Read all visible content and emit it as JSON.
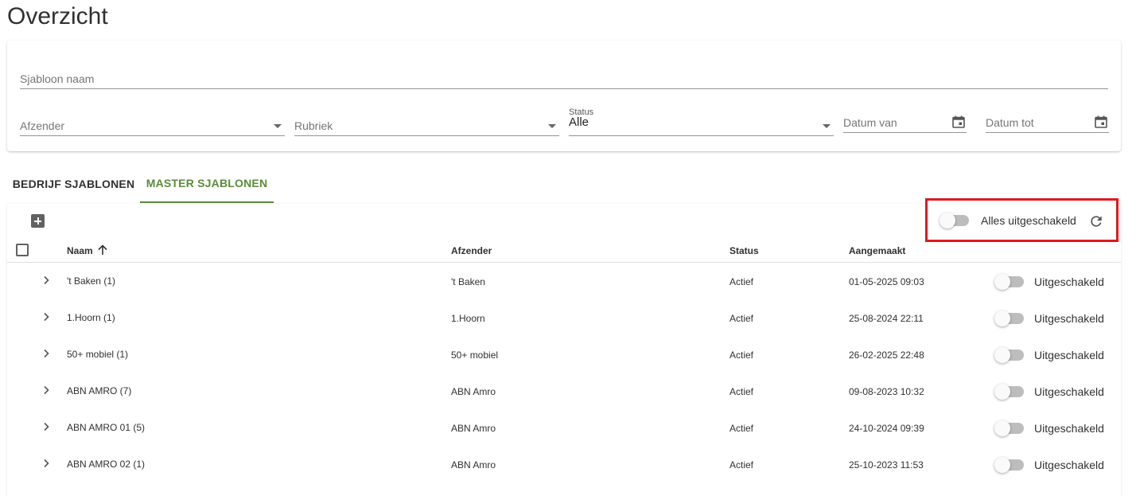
{
  "page": {
    "title": "Overzicht"
  },
  "filters": {
    "template_name_placeholder": "Sjabloon naam",
    "sender_placeholder": "Afzender",
    "category_placeholder": "Rubriek",
    "status_label": "Status",
    "status_value": "Alle",
    "date_from_placeholder": "Datum van",
    "date_to_placeholder": "Datum tot"
  },
  "tabs": [
    {
      "label": "BEDRIJF SJABLONEN",
      "active": false
    },
    {
      "label": "MASTER SJABLONEN",
      "active": true
    }
  ],
  "toolbar": {
    "all_toggle_label": "Alles uitgeschakeld"
  },
  "table": {
    "columns": {
      "name": "Naam",
      "sender": "Afzender",
      "status": "Status",
      "created": "Aangemaakt"
    },
    "rows": [
      {
        "name": "'t Baken (1)",
        "sender": "'t Baken",
        "status": "Actief",
        "created": "01-05-2025 09:03",
        "toggle_label": "Uitgeschakeld"
      },
      {
        "name": "1.Hoorn (1)",
        "sender": "1.Hoorn",
        "status": "Actief",
        "created": "25-08-2024 22:11",
        "toggle_label": "Uitgeschakeld"
      },
      {
        "name": "50+ mobiel (1)",
        "sender": "50+ mobiel",
        "status": "Actief",
        "created": "26-02-2025 22:48",
        "toggle_label": "Uitgeschakeld"
      },
      {
        "name": "ABN AMRO (7)",
        "sender": "ABN Amro",
        "status": "Actief",
        "created": "09-08-2023 10:32",
        "toggle_label": "Uitgeschakeld"
      },
      {
        "name": "ABN AMRO 01 (5)",
        "sender": "ABN Amro",
        "status": "Actief",
        "created": "24-10-2024 09:39",
        "toggle_label": "Uitgeschakeld"
      },
      {
        "name": "ABN AMRO 02 (1)",
        "sender": "ABN Amro",
        "status": "Actief",
        "created": "25-10-2023 11:53",
        "toggle_label": "Uitgeschakeld"
      }
    ]
  },
  "colors": {
    "accent": "#5b8a3c",
    "highlight": "#e0191e",
    "toggle_off": "#bdbdbd"
  },
  "icons": [
    "add-box-icon",
    "refresh-icon",
    "arrow-up-icon",
    "chevron-right-icon",
    "calendar-icon",
    "dropdown-caret-icon"
  ]
}
